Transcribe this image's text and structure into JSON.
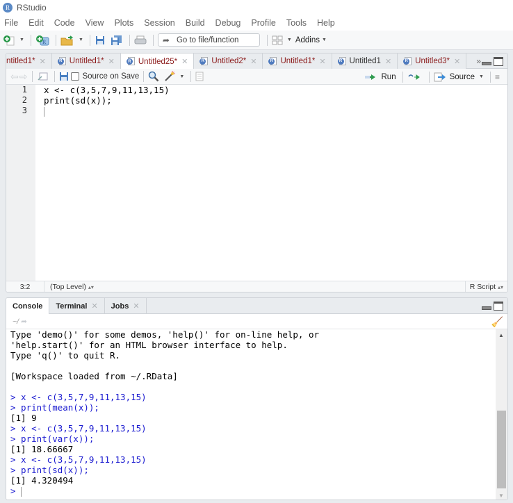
{
  "app": {
    "title": "RStudio",
    "logo_letter": "R"
  },
  "menu": [
    "File",
    "Edit",
    "Code",
    "View",
    "Plots",
    "Session",
    "Build",
    "Debug",
    "Profile",
    "Tools",
    "Help"
  ],
  "toolbar": {
    "goto_placeholder": "Go to file/function",
    "addins_label": "Addins"
  },
  "source": {
    "tabs": [
      {
        "label": "ntitled1*",
        "modified": true,
        "active": false,
        "has_icon": false
      },
      {
        "label": "Untitled1*",
        "modified": true,
        "active": false,
        "has_icon": true
      },
      {
        "label": "Untitled25*",
        "modified": true,
        "active": true,
        "has_icon": true
      },
      {
        "label": "Untitled2*",
        "modified": true,
        "active": false,
        "has_icon": true
      },
      {
        "label": "Untitled1*",
        "modified": true,
        "active": false,
        "has_icon": true
      },
      {
        "label": "Untitled1",
        "modified": false,
        "active": false,
        "has_icon": true
      },
      {
        "label": "Untitled3*",
        "modified": true,
        "active": false,
        "has_icon": true
      }
    ],
    "source_on_save_label": "Source on Save",
    "source_on_save_checked": false,
    "run_label": "Run",
    "source_label": "Source",
    "lines": [
      "x <- c(3,5,7,9,11,13,15)",
      "print(sd(x));",
      ""
    ],
    "line_numbers": [
      "1",
      "2",
      "3"
    ],
    "status": {
      "position": "3:2",
      "scope": "(Top Level)",
      "file_type": "R Script"
    }
  },
  "console": {
    "tabs": [
      {
        "label": "Console",
        "active": true,
        "closable": false
      },
      {
        "label": "Terminal",
        "active": false,
        "closable": true
      },
      {
        "label": "Jobs",
        "active": false,
        "closable": true
      }
    ],
    "working_dir": "~/",
    "lines": [
      {
        "text": "Type 'demo()' for some demos, 'help()' for on-line help, or",
        "kind": "output"
      },
      {
        "text": "'help.start()' for an HTML browser interface to help.",
        "kind": "output"
      },
      {
        "text": "Type 'q()' to quit R.",
        "kind": "output"
      },
      {
        "text": "",
        "kind": "output"
      },
      {
        "text": "[Workspace loaded from ~/.RData]",
        "kind": "output"
      },
      {
        "text": "",
        "kind": "output"
      },
      {
        "text": "> x <- c(3,5,7,9,11,13,15)",
        "kind": "input"
      },
      {
        "text": "> print(mean(x));",
        "kind": "input"
      },
      {
        "text": "[1] 9",
        "kind": "output"
      },
      {
        "text": "> x <- c(3,5,7,9,11,13,15)",
        "kind": "input"
      },
      {
        "text": "> print(var(x));",
        "kind": "input"
      },
      {
        "text": "[1] 18.66667",
        "kind": "output"
      },
      {
        "text": "> x <- c(3,5,7,9,11,13,15)",
        "kind": "input"
      },
      {
        "text": "> print(sd(x));",
        "kind": "input"
      },
      {
        "text": "[1] 4.320494",
        "kind": "output"
      }
    ],
    "prompt": "> "
  }
}
